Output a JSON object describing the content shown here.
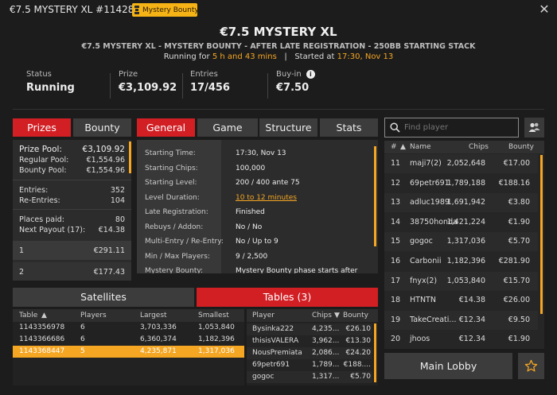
{
  "window": {
    "title": "€7.5 MYSTERY XL #1142852661",
    "badge": "Mystery Bounty",
    "close_glyph": "✕"
  },
  "header": {
    "title": "€7.5 MYSTERY XL",
    "subtitle": "€7.5 MYSTERY XL - MYSTERY BOUNTY - AFTER LATE REGISTRATION - 250BB STARTING STACK",
    "running_prefix": "Running for",
    "running_value": "5 h and 43 mins",
    "sep": "|",
    "started_prefix": "Started at",
    "started_value": "17:30, Nov 13"
  },
  "stats": [
    {
      "label": "Status",
      "value": "Running"
    },
    {
      "label": "Prize",
      "value": "€3,109.92"
    },
    {
      "label": "Entries",
      "value": "17/456"
    },
    {
      "label": "Buy-in",
      "value": "€7.50",
      "info_icon": "i"
    }
  ],
  "left_tabs": {
    "prizes": "Prizes",
    "bounty": "Bounty",
    "active": "prizes"
  },
  "prizes": {
    "pool_label": "Prize Pool:",
    "pool_value": "€3,109.92",
    "regular_label": "Regular Pool:",
    "regular_value": "€1,554.96",
    "bounty_label": "Bounty Pool:",
    "bounty_value": "€1,554.96",
    "entries_label": "Entries:",
    "entries_value": "352",
    "reentries_label": "Re-Entries:",
    "reentries_value": "104",
    "paid_label": "Places paid:",
    "paid_value": "80",
    "next_label": "Next Payout (17):",
    "next_value": "€14.38",
    "places": [
      {
        "place": "1",
        "amount": "€291.11"
      },
      {
        "place": "2",
        "amount": "€177.43"
      }
    ]
  },
  "mid_tabs": {
    "general": "General",
    "game": "Game",
    "structure": "Structure",
    "stats": "Stats",
    "active": "general"
  },
  "general": [
    {
      "key": "Starting Time:",
      "value": "17:30, Nov 13"
    },
    {
      "key": "Starting Chips:",
      "value": "100,000"
    },
    {
      "key": "Starting Level:",
      "value": "200 / 400 ante 75"
    },
    {
      "key": "Level Duration:",
      "value": "10 to 12 minutes",
      "link": true
    },
    {
      "key": "Late Registration:",
      "value": "Finished"
    },
    {
      "key": "Rebuys / Addon:",
      "value": "No / No"
    },
    {
      "key": "Multi-Entry / Re-Entry:",
      "value": "No / Up to 9"
    },
    {
      "key": "Min / Max Players:",
      "value": "9 / 2,500"
    },
    {
      "key": "Mystery Bounty:",
      "value": "Mystery Bounty phase starts after the end of"
    }
  ],
  "search": {
    "placeholder": "Find player"
  },
  "players": {
    "headers": {
      "rank": "#",
      "name": "Name",
      "chips": "Chips",
      "bounty": "Bounty",
      "sort_glyph": "▲"
    },
    "rows": [
      {
        "rank": "11",
        "name": "maji7(2)",
        "chips": "2,052,648",
        "bounty": "€17.00"
      },
      {
        "rank": "12",
        "name": "69petr691",
        "chips": "1,789,188",
        "bounty": "€188.16"
      },
      {
        "rank": "13",
        "name": "adluc1989",
        "chips": "1,691,942",
        "bounty": "€3.80"
      },
      {
        "rank": "14",
        "name": "38750honda",
        "chips": "1,421,224",
        "bounty": "€1.90"
      },
      {
        "rank": "15",
        "name": "gogoc",
        "chips": "1,317,036",
        "bounty": "€5.70"
      },
      {
        "rank": "16",
        "name": "Carbonii",
        "chips": "1,182,396",
        "bounty": "€281.90"
      },
      {
        "rank": "17",
        "name": "fnyx(2)",
        "chips": "1,053,840",
        "bounty": "€15.70"
      },
      {
        "rank": "18",
        "name": "HTNTN",
        "chips": "€14.38",
        "bounty": "€26.00"
      },
      {
        "rank": "19",
        "name": "TakeCreati...",
        "chips": "€12.34",
        "bounty": "€9.50"
      },
      {
        "rank": "20",
        "name": "jhoos",
        "chips": "€12.34",
        "bounty": "€1.90"
      }
    ]
  },
  "bottom_tabs": {
    "satellites": "Satellites",
    "tables": "Tables (3)",
    "active": "tables"
  },
  "tables": {
    "headers": {
      "table": "Table",
      "players": "Players",
      "largest": "Largest",
      "smallest": "Smallest",
      "sort_glyph": "▲"
    },
    "rows": [
      {
        "table": "1143356978",
        "players": "6",
        "largest": "3,703,336",
        "smallest": "1,053,840",
        "selected": false
      },
      {
        "table": "1143366686",
        "players": "6",
        "largest": "6,360,374",
        "smallest": "1,182,396",
        "selected": false
      },
      {
        "table": "1143368447",
        "players": "5",
        "largest": "4,235,871",
        "smallest": "1,317,036",
        "selected": true
      }
    ]
  },
  "table_players": {
    "headers": {
      "player": "Player",
      "chips": "Chips",
      "bounty": "Bounty",
      "sort_glyph": "▼"
    },
    "rows": [
      {
        "player": "Bysinka222",
        "chips": "4,235...",
        "bounty": "€26.10"
      },
      {
        "player": "thisisVALERA",
        "chips": "3,962...",
        "bounty": "€13.30"
      },
      {
        "player": "NousPremiata",
        "chips": "2,086...",
        "bounty": "€24.20"
      },
      {
        "player": "69petr691",
        "chips": "1,789...",
        "bounty": "€188...."
      },
      {
        "player": "gogoc",
        "chips": "1,317...",
        "bounty": "€5.70"
      }
    ]
  },
  "main_lobby": "Main Lobby",
  "colors": {
    "accent": "#d11f24",
    "highlight": "#f5a623",
    "badge": "#f5b316"
  }
}
